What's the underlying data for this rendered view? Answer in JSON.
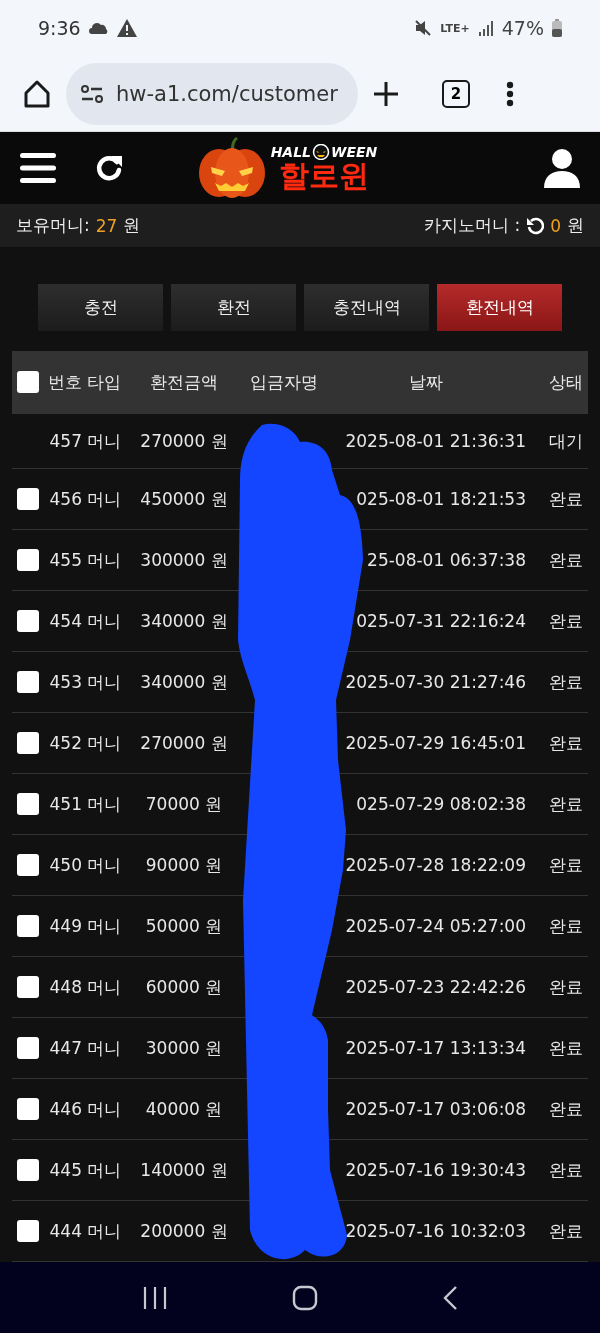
{
  "status_bar": {
    "time": "9:36",
    "network": "LTE+",
    "battery": "47%"
  },
  "browser": {
    "url": "hw-a1.com/customer",
    "tab_count": "2"
  },
  "site": {
    "logo_top_left": "HALL",
    "logo_top_right": "WEEN",
    "logo_main": "할로윈"
  },
  "balance": {
    "label": "보유머니:",
    "amount": "27",
    "unit": "원",
    "casino_label": "카지노머니 :",
    "casino_amount": "0",
    "casino_unit": "원"
  },
  "tabs": [
    {
      "label": "충전",
      "selected": false
    },
    {
      "label": "환전",
      "selected": false
    },
    {
      "label": "충전내역",
      "selected": false
    },
    {
      "label": "환전내역",
      "selected": true
    }
  ],
  "table": {
    "select_all_checked": false,
    "columns": [
      "번호",
      "타입",
      "환전금액",
      "입금자명",
      "날짜",
      "상태"
    ],
    "rows": [
      {
        "kind": "plain",
        "number": "457",
        "type": "머니",
        "amount": "270000 원",
        "date": "2025-08-01 21:36:31",
        "status": "대기"
      },
      {
        "kind": "checkbox",
        "checked": false,
        "number": "456",
        "type": "머니",
        "amount": "450000 원",
        "date": "025-08-01 18:21:53",
        "status": "완료"
      },
      {
        "kind": "checkbox",
        "checked": false,
        "number": "455",
        "type": "머니",
        "amount": "300000 원",
        "date": "25-08-01 06:37:38",
        "status": "완료"
      },
      {
        "kind": "checkbox",
        "checked": false,
        "number": "454",
        "type": "머니",
        "amount": "340000 원",
        "date": "025-07-31 22:16:24",
        "status": "완료"
      },
      {
        "kind": "checkbox",
        "checked": false,
        "number": "453",
        "type": "머니",
        "amount": "340000 원",
        "date": "2025-07-30 21:27:46",
        "status": "완료"
      },
      {
        "kind": "checkbox",
        "checked": false,
        "number": "452",
        "type": "머니",
        "amount": "270000 원",
        "date": "2025-07-29 16:45:01",
        "status": "완료"
      },
      {
        "kind": "checkbox",
        "checked": false,
        "number": "451",
        "type": "머니",
        "amount": "70000 원",
        "date": "025-07-29 08:02:38",
        "status": "완료"
      },
      {
        "kind": "checkbox",
        "checked": false,
        "number": "450",
        "type": "머니",
        "amount": "90000 원",
        "date": "2025-07-28 18:22:09",
        "status": "완료"
      },
      {
        "kind": "checkbox",
        "checked": false,
        "number": "449",
        "type": "머니",
        "amount": "50000 원",
        "date": "2025-07-24 05:27:00",
        "status": "완료"
      },
      {
        "kind": "checkbox",
        "checked": false,
        "number": "448",
        "type": "머니",
        "amount": "60000 원",
        "date": "2025-07-23 22:42:26",
        "status": "완료"
      },
      {
        "kind": "checkbox",
        "checked": false,
        "number": "447",
        "type": "머니",
        "amount": "30000 원",
        "date": "2025-07-17 13:13:34",
        "status": "완료"
      },
      {
        "kind": "checkbox",
        "checked": false,
        "number": "446",
        "type": "머니",
        "amount": "40000 원",
        "date": "2025-07-17 03:06:08",
        "status": "완료"
      },
      {
        "kind": "checkbox",
        "checked": false,
        "number": "445",
        "type": "머니",
        "amount": "140000 원",
        "date": "2025-07-16 19:30:43",
        "status": "완료"
      },
      {
        "kind": "checkbox",
        "checked": false,
        "number": "444",
        "type": "머니",
        "amount": "200000 원",
        "date": "2025-07-16 10:32:03",
        "status": "완료"
      }
    ]
  }
}
